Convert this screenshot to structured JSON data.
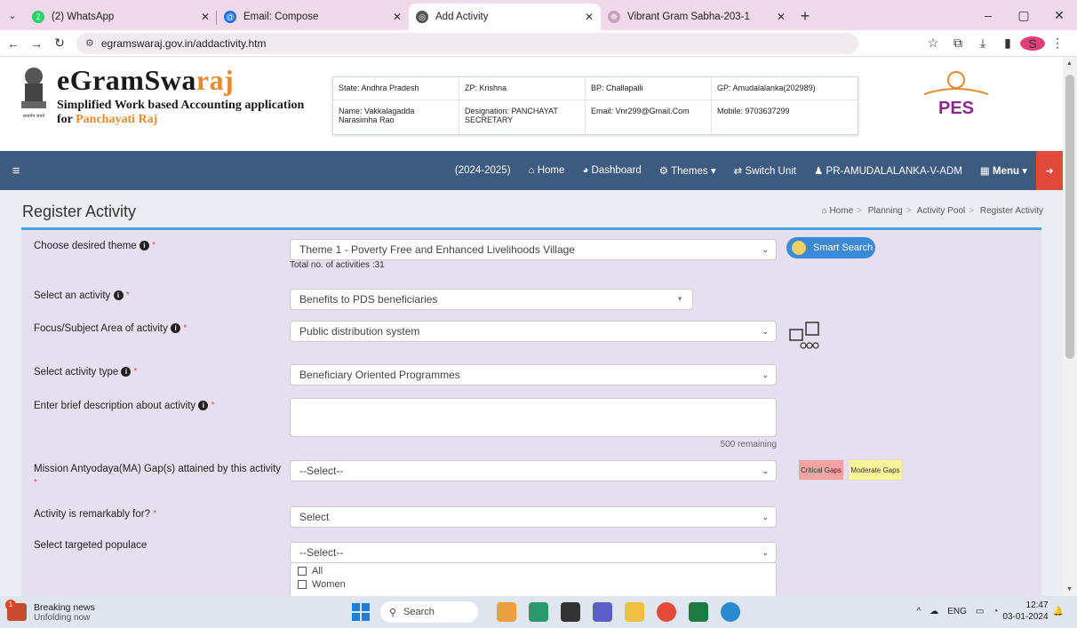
{
  "browser": {
    "tabs": [
      {
        "label": "(2) WhatsApp",
        "active": false
      },
      {
        "label": "Email: Compose",
        "active": false
      },
      {
        "label": "Add Activity",
        "active": true
      },
      {
        "label": "Vibrant Gram Sabha-203-1",
        "active": false
      }
    ],
    "url": "egramswaraj.gov.in/addactivity.htm",
    "whatsapp_badge": "2",
    "profile_initial": "S"
  },
  "header": {
    "brand_main": "eGramSwa",
    "brand_accent": "raj",
    "tagline1": "Simplified Work based Accounting application",
    "tagline2_pre": "for ",
    "tagline2_accent": "Panchayati Raj",
    "emblem_caption": "सत्यमेव जयते",
    "pes_logo_text": "PES",
    "info": {
      "state": "State: Andhra Pradesh",
      "zp": "ZP: Krishna",
      "bp": "BP: Challapalli",
      "gp": "GP: Amudalalanka(202989)",
      "name": "Name: Vakkalagadda Narasimha Rao",
      "designation": "Designation: PANCHAYAT SECRETARY",
      "email": "Email: Vnr299@Gmail.Com",
      "mobile": "Mobile: 9703637299"
    }
  },
  "navbar": {
    "year": "(2024-2025)",
    "home": "Home",
    "dashboard": "Dashboard",
    "themes": "Themes",
    "switch_unit": "Switch Unit",
    "user": "PR-AMUDALALANKA-V-ADM",
    "menu": "Menu"
  },
  "page": {
    "title": "Register Activity",
    "breadcrumb": [
      "Home",
      "Planning",
      "Activity Pool",
      "Register Activity"
    ]
  },
  "form": {
    "theme_label": "Choose desired theme",
    "theme_value": "Theme 1 - Poverty Free and Enhanced Livelihoods Village",
    "smart_search": "Smart Search",
    "total_activities": "Total no. of activities :31",
    "activity_label": "Select an activity",
    "activity_value": "Benefits to PDS beneficiaries",
    "focus_label": "Focus/Subject Area of activity",
    "focus_value": "Public distribution system",
    "type_label": "Select activity type",
    "type_value": "Beneficiary Oriented Programmes",
    "desc_label": "Enter brief description about activity",
    "remaining": "500 remaining",
    "mission_label": "Mission Antyodaya(MA) Gap(s) attained by this activity",
    "mission_value": "--Select--",
    "critical_gaps": "Critical Gaps",
    "moderate_gaps": "Moderate Gaps",
    "remarkable_label": "Activity is remarkably for?",
    "remarkable_value": "Select",
    "populace_label": "Select targeted populace",
    "populace_value": "--Select--",
    "populace_options": [
      "All",
      "Women"
    ]
  },
  "taskbar": {
    "news_title": "Breaking news",
    "news_sub": "Unfolding now",
    "news_badge": "1",
    "search": "Search",
    "lang": "ENG",
    "time": "12:47",
    "date": "03-01-2024"
  },
  "colors": {
    "navbar": "#3d5a80",
    "accent_orange": "#e68a2e",
    "form_bg": "#e5dff0",
    "critical": "#f4a3a3",
    "moderate": "#fbf59a"
  }
}
